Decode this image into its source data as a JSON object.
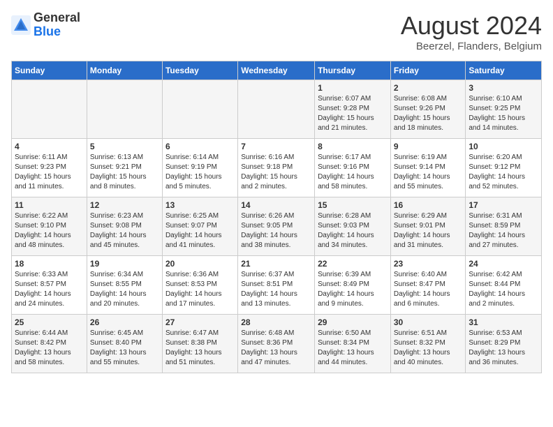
{
  "logo": {
    "line1": "General",
    "line2": "Blue"
  },
  "title": "August 2024",
  "location": "Beerzel, Flanders, Belgium",
  "days_of_week": [
    "Sunday",
    "Monday",
    "Tuesday",
    "Wednesday",
    "Thursday",
    "Friday",
    "Saturday"
  ],
  "weeks": [
    [
      {
        "day": "",
        "info": ""
      },
      {
        "day": "",
        "info": ""
      },
      {
        "day": "",
        "info": ""
      },
      {
        "day": "",
        "info": ""
      },
      {
        "day": "1",
        "info": "Sunrise: 6:07 AM\nSunset: 9:28 PM\nDaylight: 15 hours\nand 21 minutes."
      },
      {
        "day": "2",
        "info": "Sunrise: 6:08 AM\nSunset: 9:26 PM\nDaylight: 15 hours\nand 18 minutes."
      },
      {
        "day": "3",
        "info": "Sunrise: 6:10 AM\nSunset: 9:25 PM\nDaylight: 15 hours\nand 14 minutes."
      }
    ],
    [
      {
        "day": "4",
        "info": "Sunrise: 6:11 AM\nSunset: 9:23 PM\nDaylight: 15 hours\nand 11 minutes."
      },
      {
        "day": "5",
        "info": "Sunrise: 6:13 AM\nSunset: 9:21 PM\nDaylight: 15 hours\nand 8 minutes."
      },
      {
        "day": "6",
        "info": "Sunrise: 6:14 AM\nSunset: 9:19 PM\nDaylight: 15 hours\nand 5 minutes."
      },
      {
        "day": "7",
        "info": "Sunrise: 6:16 AM\nSunset: 9:18 PM\nDaylight: 15 hours\nand 2 minutes."
      },
      {
        "day": "8",
        "info": "Sunrise: 6:17 AM\nSunset: 9:16 PM\nDaylight: 14 hours\nand 58 minutes."
      },
      {
        "day": "9",
        "info": "Sunrise: 6:19 AM\nSunset: 9:14 PM\nDaylight: 14 hours\nand 55 minutes."
      },
      {
        "day": "10",
        "info": "Sunrise: 6:20 AM\nSunset: 9:12 PM\nDaylight: 14 hours\nand 52 minutes."
      }
    ],
    [
      {
        "day": "11",
        "info": "Sunrise: 6:22 AM\nSunset: 9:10 PM\nDaylight: 14 hours\nand 48 minutes."
      },
      {
        "day": "12",
        "info": "Sunrise: 6:23 AM\nSunset: 9:08 PM\nDaylight: 14 hours\nand 45 minutes."
      },
      {
        "day": "13",
        "info": "Sunrise: 6:25 AM\nSunset: 9:07 PM\nDaylight: 14 hours\nand 41 minutes."
      },
      {
        "day": "14",
        "info": "Sunrise: 6:26 AM\nSunset: 9:05 PM\nDaylight: 14 hours\nand 38 minutes."
      },
      {
        "day": "15",
        "info": "Sunrise: 6:28 AM\nSunset: 9:03 PM\nDaylight: 14 hours\nand 34 minutes."
      },
      {
        "day": "16",
        "info": "Sunrise: 6:29 AM\nSunset: 9:01 PM\nDaylight: 14 hours\nand 31 minutes."
      },
      {
        "day": "17",
        "info": "Sunrise: 6:31 AM\nSunset: 8:59 PM\nDaylight: 14 hours\nand 27 minutes."
      }
    ],
    [
      {
        "day": "18",
        "info": "Sunrise: 6:33 AM\nSunset: 8:57 PM\nDaylight: 14 hours\nand 24 minutes."
      },
      {
        "day": "19",
        "info": "Sunrise: 6:34 AM\nSunset: 8:55 PM\nDaylight: 14 hours\nand 20 minutes."
      },
      {
        "day": "20",
        "info": "Sunrise: 6:36 AM\nSunset: 8:53 PM\nDaylight: 14 hours\nand 17 minutes."
      },
      {
        "day": "21",
        "info": "Sunrise: 6:37 AM\nSunset: 8:51 PM\nDaylight: 14 hours\nand 13 minutes."
      },
      {
        "day": "22",
        "info": "Sunrise: 6:39 AM\nSunset: 8:49 PM\nDaylight: 14 hours\nand 9 minutes."
      },
      {
        "day": "23",
        "info": "Sunrise: 6:40 AM\nSunset: 8:47 PM\nDaylight: 14 hours\nand 6 minutes."
      },
      {
        "day": "24",
        "info": "Sunrise: 6:42 AM\nSunset: 8:44 PM\nDaylight: 14 hours\nand 2 minutes."
      }
    ],
    [
      {
        "day": "25",
        "info": "Sunrise: 6:44 AM\nSunset: 8:42 PM\nDaylight: 13 hours\nand 58 minutes."
      },
      {
        "day": "26",
        "info": "Sunrise: 6:45 AM\nSunset: 8:40 PM\nDaylight: 13 hours\nand 55 minutes."
      },
      {
        "day": "27",
        "info": "Sunrise: 6:47 AM\nSunset: 8:38 PM\nDaylight: 13 hours\nand 51 minutes."
      },
      {
        "day": "28",
        "info": "Sunrise: 6:48 AM\nSunset: 8:36 PM\nDaylight: 13 hours\nand 47 minutes."
      },
      {
        "day": "29",
        "info": "Sunrise: 6:50 AM\nSunset: 8:34 PM\nDaylight: 13 hours\nand 44 minutes."
      },
      {
        "day": "30",
        "info": "Sunrise: 6:51 AM\nSunset: 8:32 PM\nDaylight: 13 hours\nand 40 minutes."
      },
      {
        "day": "31",
        "info": "Sunrise: 6:53 AM\nSunset: 8:29 PM\nDaylight: 13 hours\nand 36 minutes."
      }
    ]
  ]
}
